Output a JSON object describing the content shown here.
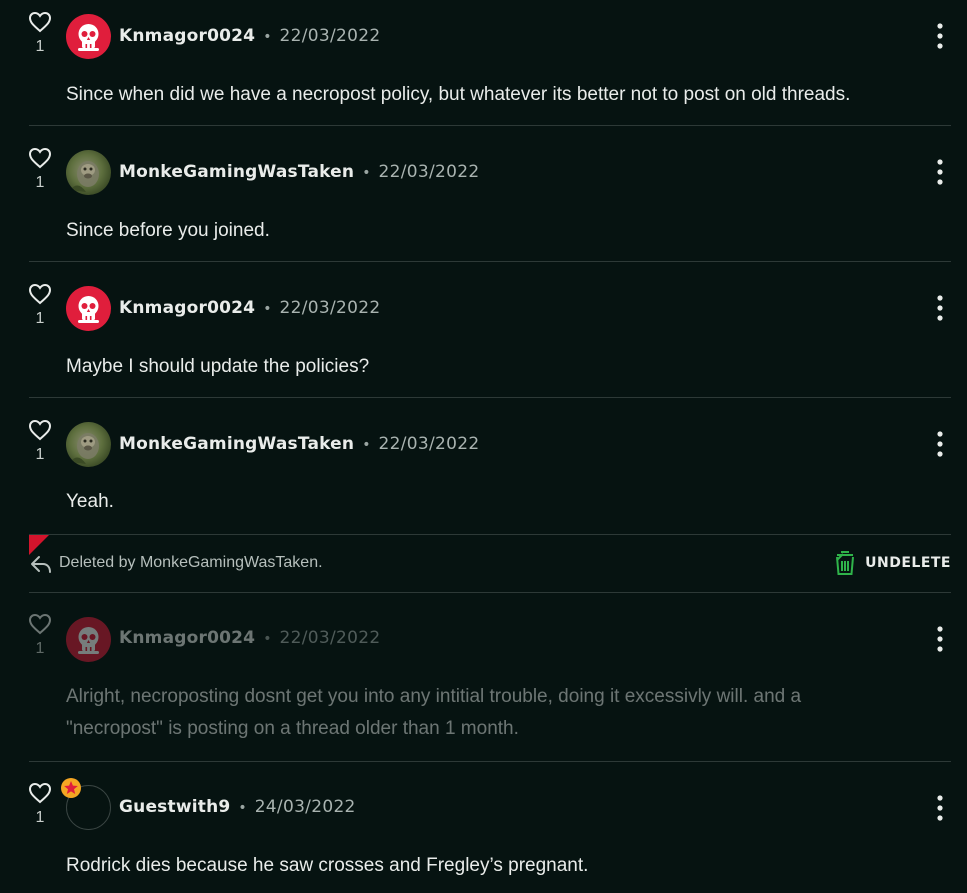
{
  "colors": {
    "background": "#061311",
    "divider": "#2d3937",
    "skull_avatar": "#e01e3c",
    "deleted_accent": "#d3142c",
    "undelete_icon": "#2fb34a",
    "badge": "#f5a623"
  },
  "posts": [
    {
      "username": "Knmagor0024",
      "separator": "•",
      "date": "22/03/2022",
      "likes": "1",
      "avatar_icon": "skull-icon",
      "body_lines": [
        "Since when did we have a necropost policy, but whatever its better not to post on old threads."
      ]
    },
    {
      "username": "MonkeGamingWasTaken",
      "separator": "•",
      "date": "22/03/2022",
      "likes": "1",
      "avatar_icon": "monkey-avatar",
      "body_lines": [
        "Since before you joined."
      ]
    },
    {
      "username": "Knmagor0024",
      "separator": "•",
      "date": "22/03/2022",
      "likes": "1",
      "avatar_icon": "skull-icon",
      "body_lines": [
        "Maybe I should update the policies?"
      ]
    },
    {
      "username": "MonkeGamingWasTaken",
      "separator": "•",
      "date": "22/03/2022",
      "likes": "1",
      "avatar_icon": "monkey-avatar",
      "body_lines": [
        "Yeah."
      ]
    },
    {
      "username": "Knmagor0024",
      "separator": "•",
      "date": "22/03/2022",
      "likes": "1",
      "avatar_icon": "skull-icon",
      "deleted": true,
      "body_lines": [
        "Alright, necroposting dosnt get you into any intitial trouble, doing it excessivly will. and a",
        "\"necropost\" is posting on a thread older than 1 month."
      ]
    },
    {
      "username": "Guestwith9",
      "separator": "•",
      "date": "24/03/2022",
      "likes": "1",
      "avatar_icon": "empty-avatar",
      "badge_icon": "star-badge-icon",
      "body_lines": [
        "Rodrick dies because he saw crosses and Fregley’s pregnant."
      ]
    }
  ],
  "deleted_notice": {
    "text": "Deleted by MonkeGamingWasTaken.",
    "undelete_label": "UNDELETE",
    "icon": "reply-arrow-icon",
    "undelete_icon": "trash-restore-icon"
  },
  "menu_icon": "more-vertical-icon",
  "like_icon": "heart-outline-icon"
}
